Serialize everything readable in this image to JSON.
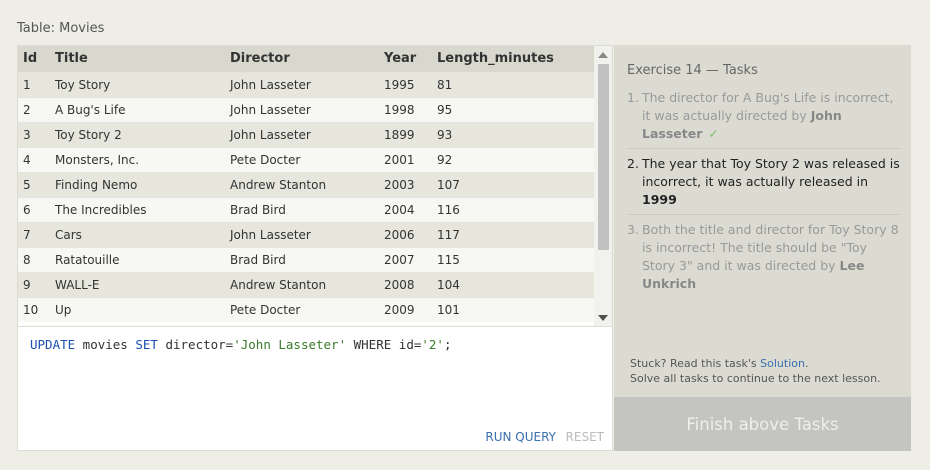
{
  "table_caption": "Table: Movies",
  "table": {
    "columns": [
      "Id",
      "Title",
      "Director",
      "Year",
      "Length_minutes"
    ],
    "rows": [
      [
        "1",
        "Toy Story",
        "John Lasseter",
        "1995",
        "81"
      ],
      [
        "2",
        "A Bug's Life",
        "John Lasseter",
        "1998",
        "95"
      ],
      [
        "3",
        "Toy Story 2",
        "John Lasseter",
        "1899",
        "93"
      ],
      [
        "4",
        "Monsters, Inc.",
        "Pete Docter",
        "2001",
        "92"
      ],
      [
        "5",
        "Finding Nemo",
        "Andrew Stanton",
        "2003",
        "107"
      ],
      [
        "6",
        "The Incredibles",
        "Brad Bird",
        "2004",
        "116"
      ],
      [
        "7",
        "Cars",
        "John Lasseter",
        "2006",
        "117"
      ],
      [
        "8",
        "Ratatouille",
        "Brad Bird",
        "2007",
        "115"
      ],
      [
        "9",
        "WALL-E",
        "Andrew Stanton",
        "2008",
        "104"
      ],
      [
        "10",
        "Up",
        "Pete Docter",
        "2009",
        "101"
      ]
    ]
  },
  "editor": {
    "code": {
      "kw_update": "UPDATE",
      "table_name": " movies ",
      "kw_set": "SET",
      "set_clause": " director=",
      "str_director": "'John Lasseter'",
      "kw_where": " WHERE",
      "where_clause": " id=",
      "str_id": "'2'",
      "terminator": ";"
    },
    "run_label": "RUN QUERY",
    "reset_label": "RESET"
  },
  "tasks": {
    "title": "Exercise 14 — Tasks",
    "items": [
      {
        "num": "1.",
        "text": "The director for A Bug's Life is incorrect, it was actually directed by ",
        "bold": "John Lasseter",
        "check": "✓"
      },
      {
        "num": "2.",
        "text": "The year that Toy Story 2 was released is incorrect, it was actually released in ",
        "bold": "1999"
      },
      {
        "num": "3.",
        "text": "Both the title and director for Toy Story 8 is incorrect! The title should be \"Toy Story 3\" and it was directed by ",
        "bold": "Lee Unkrich"
      }
    ],
    "stuck_prefix": "Stuck? Read this task's ",
    "solution_link": "Solution",
    "stuck_suffix": ".",
    "continue_text": "Solve all tasks to continue to the next lesson."
  },
  "finish_label": "Finish above Tasks",
  "colors": {
    "keyword": "#1a4fb0",
    "string": "#3a7a2a",
    "link": "#3a6fb0",
    "check": "#7bbf6a"
  }
}
